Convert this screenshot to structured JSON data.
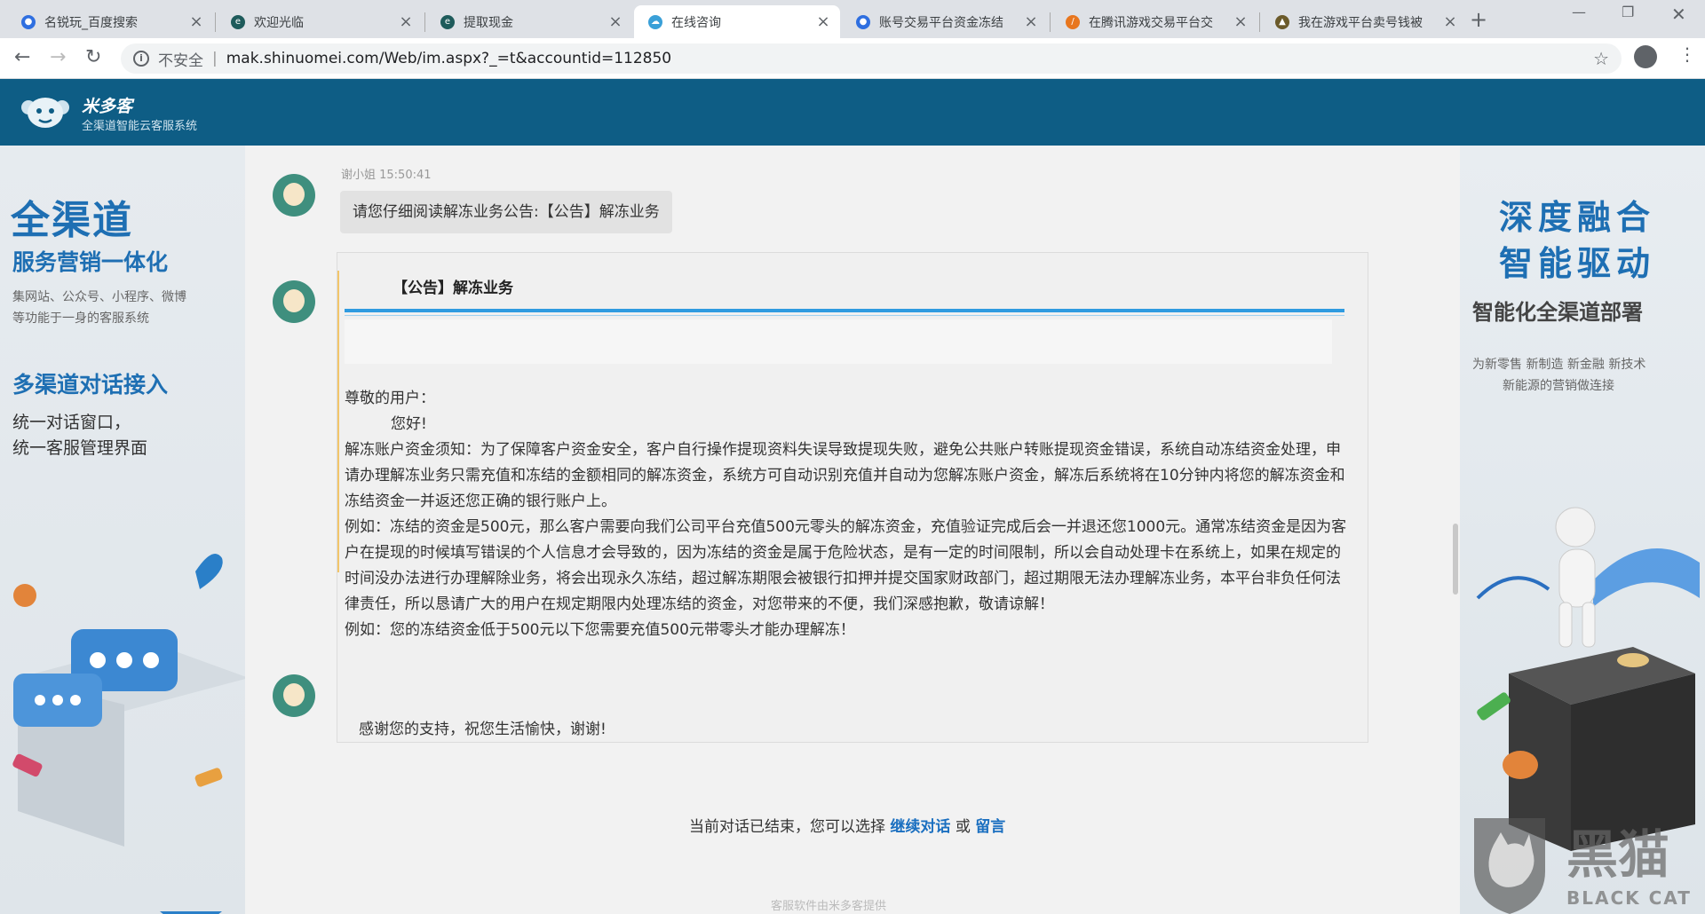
{
  "browser": {
    "tabs": [
      {
        "title": "名锐玩_百度搜索",
        "favicon": "baidu-paw-icon",
        "active": false
      },
      {
        "title": "欢迎光临",
        "favicon": "site-icon",
        "active": false
      },
      {
        "title": "提取现金",
        "favicon": "site-icon",
        "active": false
      },
      {
        "title": "在线咨询",
        "favicon": "cloud-chat-icon",
        "active": true
      },
      {
        "title": "账号交易平台资金冻结",
        "favicon": "baidu-paw-icon",
        "active": false
      },
      {
        "title": "在腾讯游戏交易平台交",
        "favicon": "swoosh-icon",
        "active": false
      },
      {
        "title": "我在游戏平台卖号钱被",
        "favicon": "cat-icon",
        "active": false
      }
    ],
    "insecure_label": "不安全",
    "url": "mak.shinuomei.com/Web/im.aspx?_=t&accountid=112850"
  },
  "header": {
    "brand": "米多客",
    "subtitle": "全渠道智能云客服系统"
  },
  "left_banner": {
    "headline": "全渠道",
    "subhead": "服务营销一体化",
    "desc1": "集网站、公众号、小程序、微博",
    "desc2": "等功能于一身的客服系统",
    "section": "多渠道对话接入",
    "line1": "统一对话窗口，",
    "line2": "统一客服管理界面"
  },
  "right_banner": {
    "headline1": "深度融合",
    "headline2": "智能驱动",
    "subhead": "智能化全渠道部署",
    "desc1": "为新零售 新制造 新金融 新技术",
    "desc2": "新能源的营销做连接"
  },
  "chat": {
    "sender": "谢小姐 15:50:41",
    "message": "请您仔细阅读解冻业务公告:【公告】解冻业务",
    "ended_prefix": "当前对话已结束，您可以选择",
    "continue_link": "继续对话",
    "or_text": "或",
    "leave_msg_link": "留言",
    "footer": "客服软件由米多客提供"
  },
  "modal": {
    "title": "【公告】解冻业务",
    "greeting": "尊敬的用户：",
    "hello": "您好!",
    "para1": "解冻账户资金须知：为了保障客户资金安全，客户自行操作提现资料失误导致提现失败，避免公共账户转账提现资金错误，系统自动冻结资金处理，申请办理解冻业务只需充值和冻结的金额相同的解冻资金，系统方可自动识别充值并自动为您解冻账户资金，解冻后系统将在10分钟内将您的解冻资金和冻结资金一并返还您正确的银行账户上。",
    "para2": "例如：冻结的资金是500元，那么客户需要向我们公司平台充值500元零头的解冻资金，充值验证完成后会一并退还您1000元。通常冻结资金是因为客户在提现的时候填写错误的个人信息才会导致的，因为冻结的资金是属于危险状态，是有一定的时间限制，所以会自动处理卡在系统上，如果在规定的时间没办法进行办理解除业务，将会出现永久冻结，超过解冻期限会被银行扣押并提交国家财政部门，超过期限无法办理解冻业务，本平台非负任何法律责任，所以恳请广大的用户在规定期限内处理冻结的资金，对您带来的不便，我们深感抱歉，敬请谅解！",
    "para3": "例如：您的冻结资金低于500元以下您需要充值500元带零头才能办理解冻！",
    "thanks": "感谢您的支持，祝您生活愉快，谢谢!"
  },
  "watermark": {
    "cn": "黑猫",
    "en": "BLACK CAT"
  },
  "colors": {
    "header_bg": "#0e5d85",
    "link": "#1a6fc0",
    "modal_rule": "#2f9be0"
  }
}
